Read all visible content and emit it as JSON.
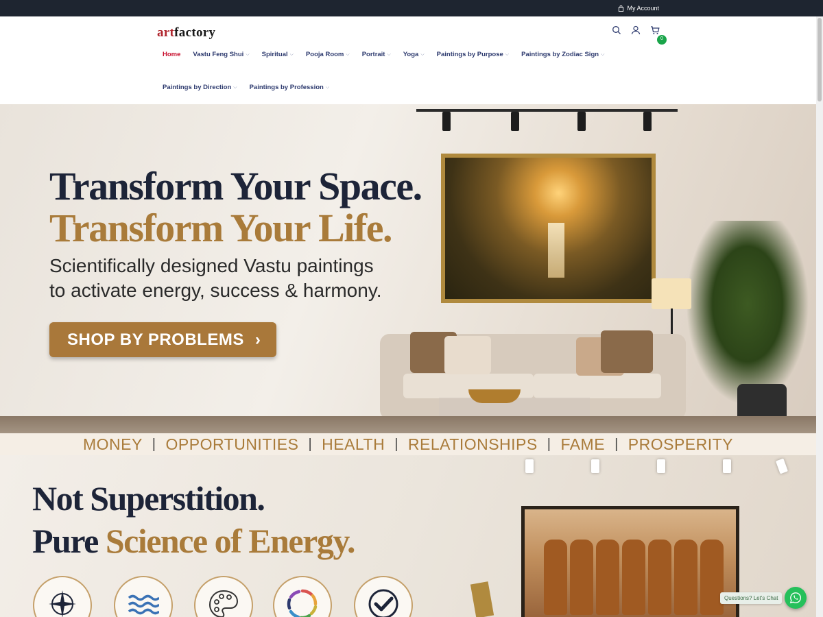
{
  "topbar": {
    "account_label": "My Account"
  },
  "header": {
    "logo_art": "art",
    "logo_factory": "factory",
    "cart_count": "0"
  },
  "nav": {
    "row1": [
      {
        "label": "Home",
        "dropdown": false,
        "active": true
      },
      {
        "label": "Vastu Feng Shui",
        "dropdown": true
      },
      {
        "label": "Spiritual",
        "dropdown": true
      },
      {
        "label": "Pooja Room",
        "dropdown": true
      },
      {
        "label": "Portrait",
        "dropdown": true
      },
      {
        "label": "Yoga",
        "dropdown": true
      },
      {
        "label": "Paintings by Purpose",
        "dropdown": true
      },
      {
        "label": "Paintings by Zodiac Sign",
        "dropdown": true
      }
    ],
    "row2": [
      {
        "label": "Paintings by Direction",
        "dropdown": true
      },
      {
        "label": "Paintings by Profession",
        "dropdown": true
      }
    ]
  },
  "hero": {
    "headline1": "Transform Your Space.",
    "headline2": "Transform Your Life.",
    "sub1": "Scientifically designed Vastu paintings",
    "sub2": "to activate energy, success & harmony.",
    "cta_label": "SHOP BY PROBLEMS",
    "cta_arrow": "›"
  },
  "problems": [
    "MONEY",
    "OPPORTUNITIES",
    "HEALTH",
    "RELATIONSHIPS",
    "FAME",
    "PROSPERITY"
  ],
  "section2": {
    "line1": "Not Superstition.",
    "line2_a": "Pure ",
    "line2_b": "Science of Energy.",
    "features": [
      "compass-icon",
      "water-waves-icon",
      "palette-icon",
      "color-wheel-icon",
      "checkmark-icon"
    ]
  },
  "chat": {
    "label": "Questions? Let's Chat"
  },
  "colors": {
    "accent_gold": "#a97b3a",
    "navy": "#1d2438",
    "nav": "#2d3a6e",
    "active": "#c8102e",
    "topbar": "#1e2530",
    "whatsapp": "#25c05a"
  }
}
